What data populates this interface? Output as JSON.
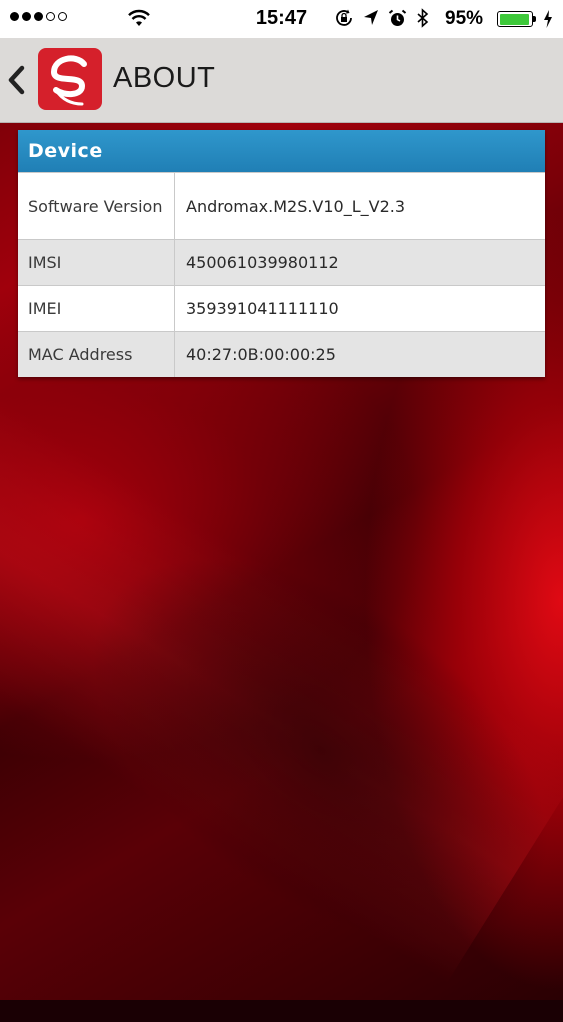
{
  "status_bar": {
    "time": "15:47",
    "battery_percent": "95%",
    "battery_level": 0.95,
    "signal_dots_filled": 3,
    "signal_dots_total": 5,
    "icons": [
      "wifi-icon",
      "orientation-lock-icon",
      "location-arrow-icon",
      "alarm-icon",
      "bluetooth-icon",
      "battery-icon",
      "charging-bolt-icon"
    ]
  },
  "header": {
    "title": "ABOUT",
    "back_icon": "chevron-left-icon",
    "logo_icon": "app-logo-icon"
  },
  "device_table": {
    "title": "Device",
    "rows": [
      {
        "label": "Software Version",
        "value": "Andromax.M2S.V10_L_V2.3"
      },
      {
        "label": "IMSI",
        "value": "450061039980112"
      },
      {
        "label": "IMEI",
        "value": "359391041111110"
      },
      {
        "label": "MAC Address",
        "value": "40:27:0B:00:00:25"
      }
    ]
  },
  "colors": {
    "table_header": "#2a8cc3",
    "app_logo": "#d5202b",
    "header_bar": "#dcdad8",
    "background": "#8a0008",
    "battery_fill": "#3ec93a"
  }
}
